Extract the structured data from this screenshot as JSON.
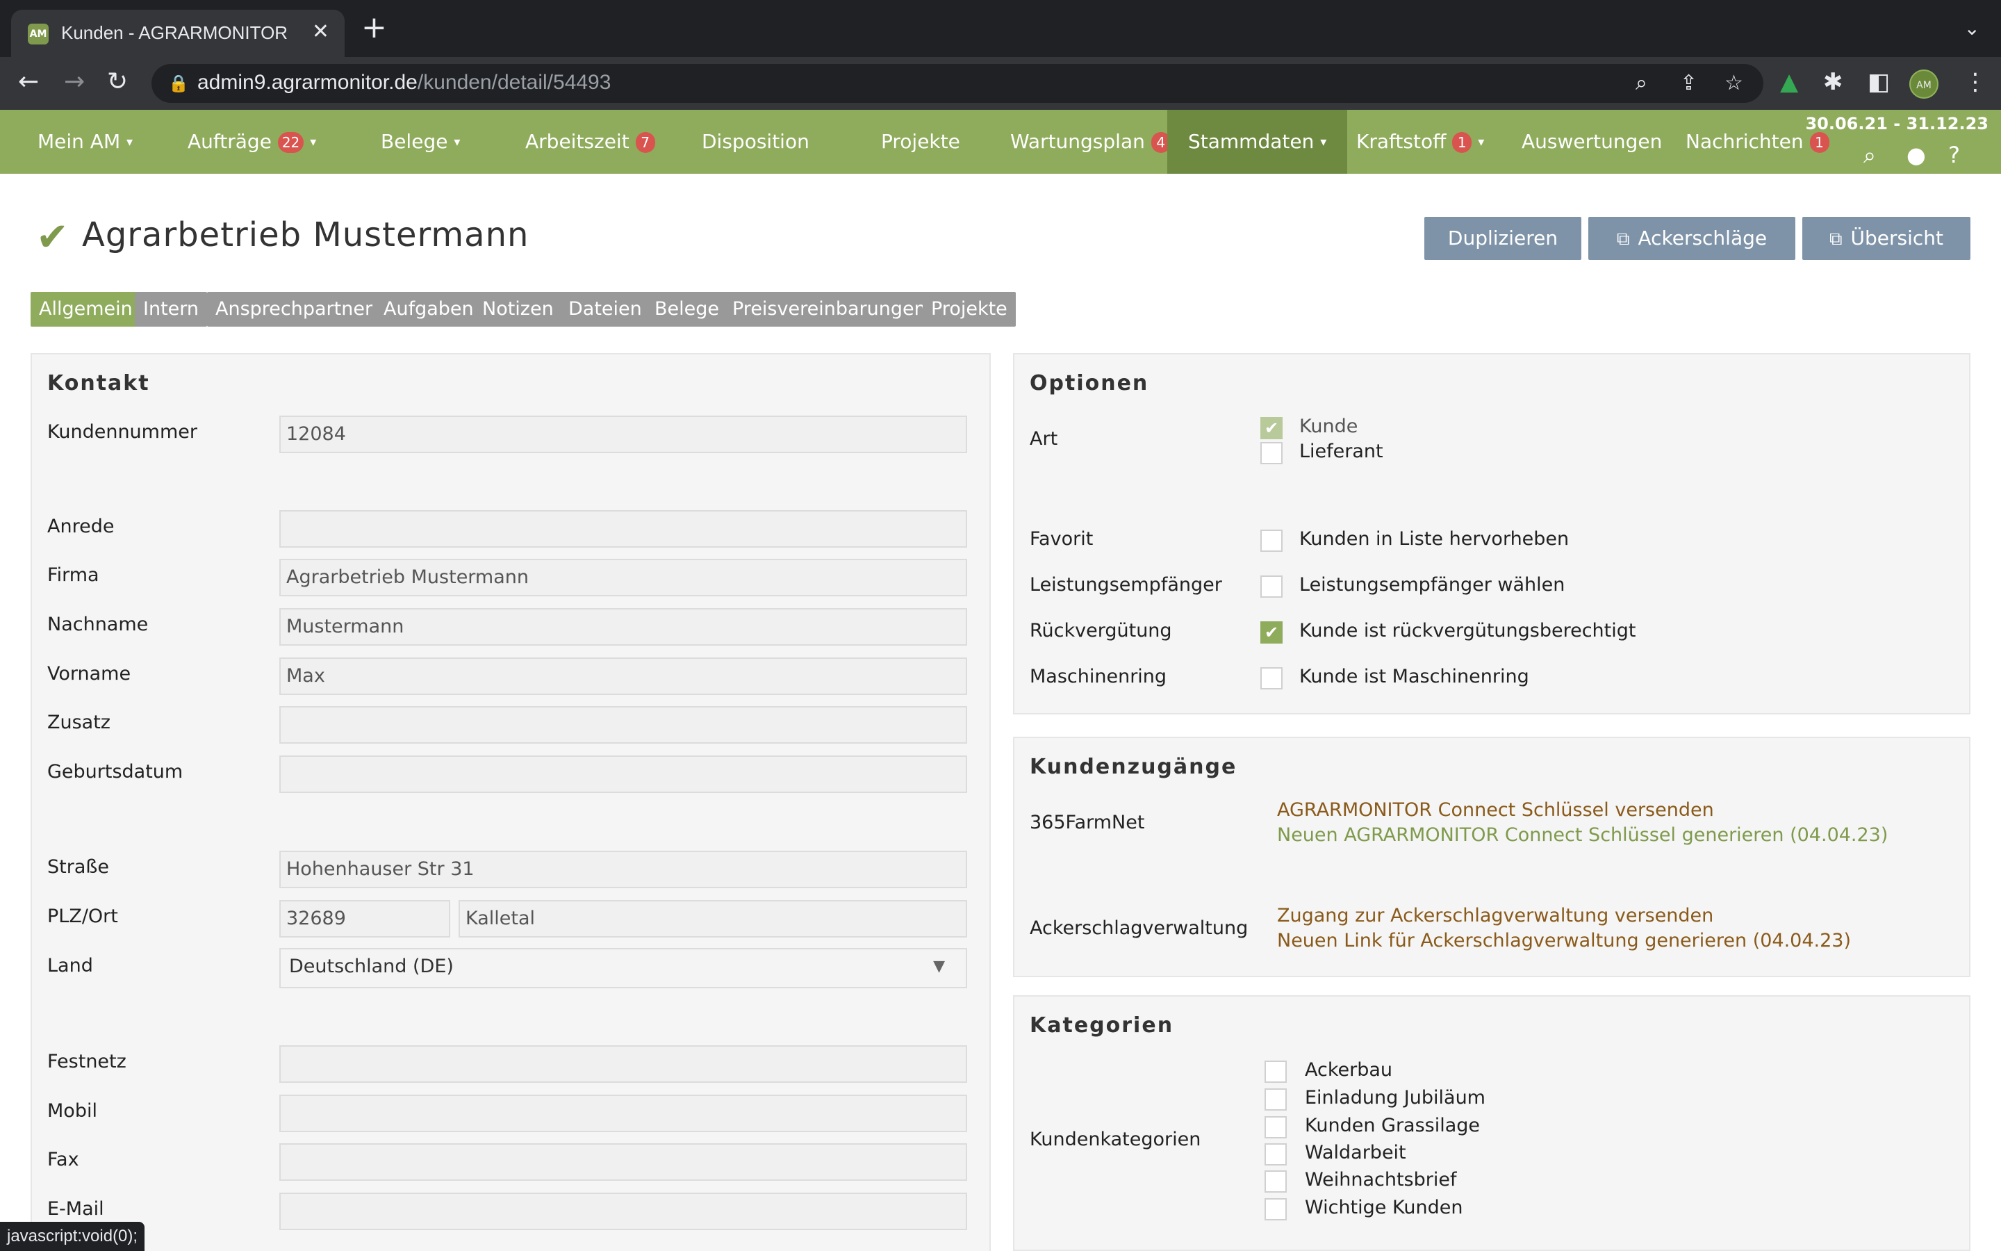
{
  "browser": {
    "tab_title": "Kunden - AGRARMONITOR",
    "favicon_text": "AM",
    "url_host": "admin9.agrarmonitor.de",
    "url_path": "/kunden/detail/54493",
    "profile_initials": "AM",
    "status_text": "javascript:void(0);"
  },
  "nav": {
    "items": [
      {
        "label": "Mein AM",
        "caret": "▾"
      },
      {
        "label": "Aufträge",
        "badge": "22",
        "caret": "▾"
      },
      {
        "label": "Belege",
        "caret": "▾"
      },
      {
        "label": "Arbeitszeit",
        "badge": "7"
      },
      {
        "label": "Disposition"
      },
      {
        "label": "Projekte"
      },
      {
        "label": "Wartungsplan",
        "badge": "4"
      },
      {
        "label": "Stammdaten",
        "caret": "▾"
      },
      {
        "label": "Kraftstoff",
        "badge": "1",
        "caret": "▾"
      },
      {
        "label": "Auswertungen"
      },
      {
        "label": "Nachrichten",
        "badge": "1"
      }
    ],
    "period": "30.06.21 - 31.12.23"
  },
  "page": {
    "title": "Agrarbetrieb Mustermann",
    "buttons": {
      "duplicate": "Duplizieren",
      "fields": "Ackerschläge",
      "overview": "Übersicht"
    },
    "subtabs": [
      "Allgemein",
      "Intern",
      "Ansprechpartner",
      "Aufgaben",
      "Notizen",
      "Dateien",
      "Belege",
      "Preisvereinbarungen",
      "Projekte"
    ]
  },
  "kontakt": {
    "title": "Kontakt",
    "kundennummer_label": "Kundennummer",
    "kundennummer": "12084",
    "anrede_label": "Anrede",
    "anrede": "",
    "firma_label": "Firma",
    "firma": "Agrarbetrieb Mustermann",
    "nachname_label": "Nachname",
    "nachname": "Mustermann",
    "vorname_label": "Vorname",
    "vorname": "Max",
    "zusatz_label": "Zusatz",
    "zusatz": "",
    "geburtsdatum_label": "Geburtsdatum",
    "geburtsdatum": "",
    "strasse_label": "Straße",
    "strasse": "Hohenhauser Str 31",
    "plzort_label": "PLZ/Ort",
    "plz": "32689",
    "ort": "Kalletal",
    "land_label": "Land",
    "land": "Deutschland (DE)",
    "festnetz_label": "Festnetz",
    "festnetz": "",
    "mobil_label": "Mobil",
    "mobil": "",
    "fax_label": "Fax",
    "fax": "",
    "email_label": "E-Mail",
    "email": ""
  },
  "optionen": {
    "title": "Optionen",
    "art_label": "Art",
    "kunde": "Kunde",
    "kunde_checked": true,
    "lieferant": "Lieferant",
    "lieferant_checked": false,
    "favorit_label": "Favorit",
    "favorit_text": "Kunden in Liste hervorheben",
    "leistung_label": "Leistungsempfänger",
    "leistung_text": "Leistungsempfänger wählen",
    "rueck_label": "Rückvergütung",
    "rueck_text": "Kunde ist rückvergütungsberechtigt",
    "rueck_checked": true,
    "maschinenring_label": "Maschinenring",
    "maschinenring_text": "Kunde ist Maschinenring"
  },
  "zugaenge": {
    "title": "Kundenzugänge",
    "farmnet_label": "365FarmNet",
    "farmnet_send": "AGRARMONITOR Connect Schlüssel versenden",
    "farmnet_new": "Neuen AGRARMONITOR Connect Schlüssel generieren (04.04.23)",
    "acker_label": "Ackerschlagverwaltung",
    "acker_send": "Zugang zur Ackerschlagverwaltung versenden",
    "acker_new": "Neuen Link für Ackerschlagverwaltung generieren (04.04.23)"
  },
  "kategorien": {
    "title": "Kategorien",
    "label": "Kundenkategorien",
    "items": [
      "Ackerbau",
      "Einladung Jubiläum",
      "Kunden Grassilage",
      "Waldarbeit",
      "Weihnachtsbrief",
      "Wichtige Kunden"
    ]
  },
  "colors": {
    "brand": "#8fab5c",
    "brand_dark": "#6d8a40",
    "badge": "#d9534f",
    "action": "#7f93a8"
  }
}
